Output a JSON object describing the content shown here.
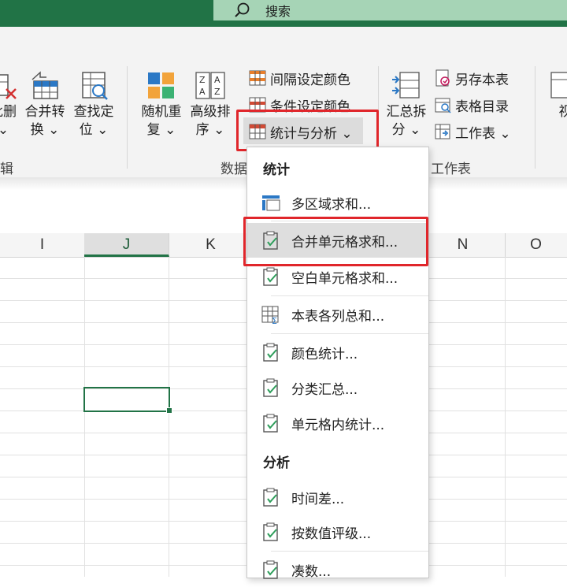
{
  "titlebar": {
    "search_placeholder": "搜索"
  },
  "ribbon": {
    "large_buttons": [
      {
        "line1": "批删",
        "line2": "⌄"
      },
      {
        "line1": "合并转",
        "line2": "换 ⌄"
      },
      {
        "line1": "查找定",
        "line2": "位 ⌄"
      },
      {
        "line1": "随机重",
        "line2": "复 ⌄"
      },
      {
        "line1": "高级排",
        "line2": "序 ⌄"
      },
      {
        "line1": "汇总拆",
        "line2": "分 ⌄"
      },
      {
        "line1": "视",
        "line2": ""
      }
    ],
    "small_buttons": {
      "interval_color": "间隔设定颜色",
      "condition_color": "条件设定颜色",
      "stats_analysis": "统计与分析 ⌄",
      "save_sheet": "另存本表",
      "sheet_directory": "表格目录",
      "worksheet": "工作表 ⌄"
    },
    "group_labels": {
      "left": "辑",
      "data": "数据",
      "worksheet": "工作表"
    }
  },
  "sheet": {
    "columns": [
      "I",
      "J",
      "K",
      "N",
      "O"
    ],
    "active_column": "J"
  },
  "menu": {
    "section_stats": "统计",
    "section_analysis": "分析",
    "stats_items": [
      "多区域求和...",
      "合并单元格求和...",
      "空白单元格求和...",
      "本表各列总和...",
      "颜色统计...",
      "分类汇总...",
      "单元格内统计..."
    ],
    "analysis_items": [
      "时间差...",
      "按数值评级...",
      "凑数..."
    ]
  },
  "colors": {
    "excel_green": "#217346",
    "highlight_red": "#e0262b"
  }
}
